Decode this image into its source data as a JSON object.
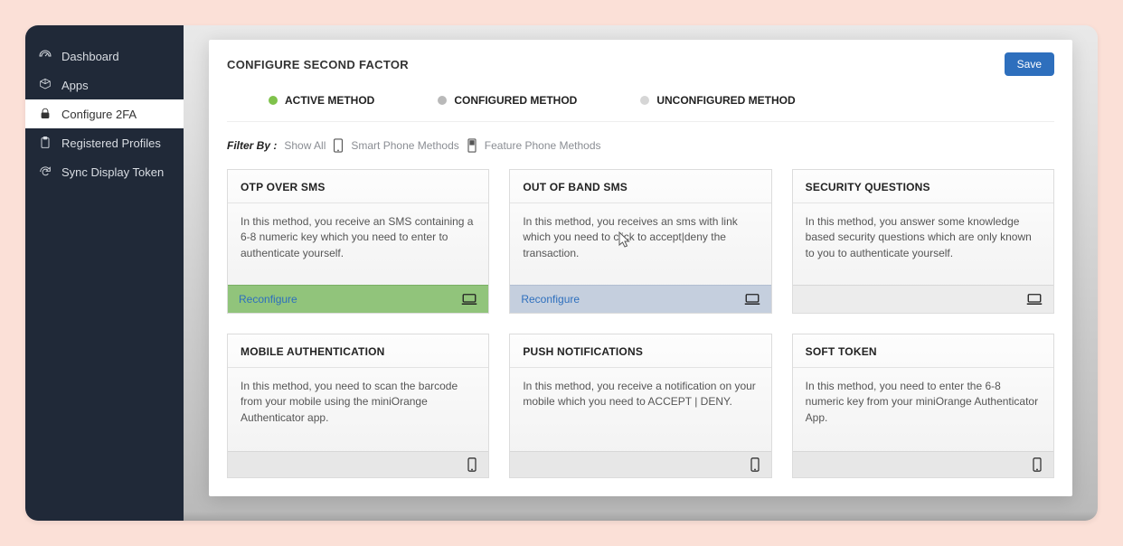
{
  "sidebar": {
    "items": [
      {
        "label": "Dashboard"
      },
      {
        "label": "Apps"
      },
      {
        "label": "Configure 2FA"
      },
      {
        "label": "Registered Profiles"
      },
      {
        "label": "Sync Display Token"
      }
    ]
  },
  "panel": {
    "title": "CONFIGURE SECOND FACTOR",
    "save_label": "Save"
  },
  "legend": {
    "active": "ACTIVE METHOD",
    "configured": "CONFIGURED METHOD",
    "unconfigured": "UNCONFIGURED METHOD"
  },
  "filter": {
    "label": "Filter By :",
    "all": "Show All",
    "smart": "Smart Phone Methods",
    "feature": "Feature Phone Methods"
  },
  "cards": [
    {
      "title": "OTP OVER SMS",
      "body": "In this method, you receive an SMS containing a 6-8 numeric key which you need to enter to authenticate yourself.",
      "action": "Reconfigure",
      "foot_style": "green",
      "device": "laptop"
    },
    {
      "title": "OUT OF BAND SMS",
      "body": "In this method, you receives an sms with link which you need to click to accept|deny the transaction.",
      "action": "Reconfigure",
      "foot_style": "blue",
      "device": "laptop"
    },
    {
      "title": "SECURITY QUESTIONS",
      "body": "In this method, you answer some knowledge based security questions which are only known to you to authenticate yourself.",
      "action": "",
      "foot_style": "plain",
      "device": "laptop"
    },
    {
      "title": "MOBILE AUTHENTICATION",
      "body": "In this method, you need to scan the barcode from your mobile using the miniOrange Authenticator app.",
      "action": "",
      "foot_style": "thin",
      "device": "phone"
    },
    {
      "title": "PUSH NOTIFICATIONS",
      "body": "In this method, you receive a notification on your mobile which you need to ACCEPT | DENY.",
      "action": "",
      "foot_style": "thin",
      "device": "phone"
    },
    {
      "title": "SOFT TOKEN",
      "body": "In this method, you need to enter the 6-8 numeric key from your miniOrange Authenticator App.",
      "action": "",
      "foot_style": "thin",
      "device": "phone"
    }
  ]
}
